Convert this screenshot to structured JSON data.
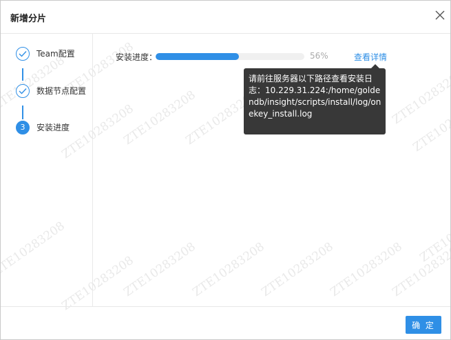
{
  "dialog": {
    "title": "新增分片"
  },
  "steps": [
    {
      "label": "Team配置",
      "state": "done"
    },
    {
      "label": "数据节点配置",
      "state": "done"
    },
    {
      "label": "安装进度",
      "state": "active",
      "number": "3"
    }
  ],
  "progress": {
    "label": "安装进度：",
    "value": 56,
    "percent_text": "56%"
  },
  "details": {
    "link_label": "查看详情",
    "tooltip_text": "请前往服务器以下路径查看安装日志：10.229.31.224:/home/goldendb/insight/scripts/install/log/onekey_install.log"
  },
  "footer": {
    "confirm_label": "确 定"
  },
  "watermark": {
    "text": "ZTE10283208"
  },
  "colors": {
    "accent": "#2f8fe6",
    "tooltip_bg": "#383838",
    "track": "#f0f0f0"
  }
}
